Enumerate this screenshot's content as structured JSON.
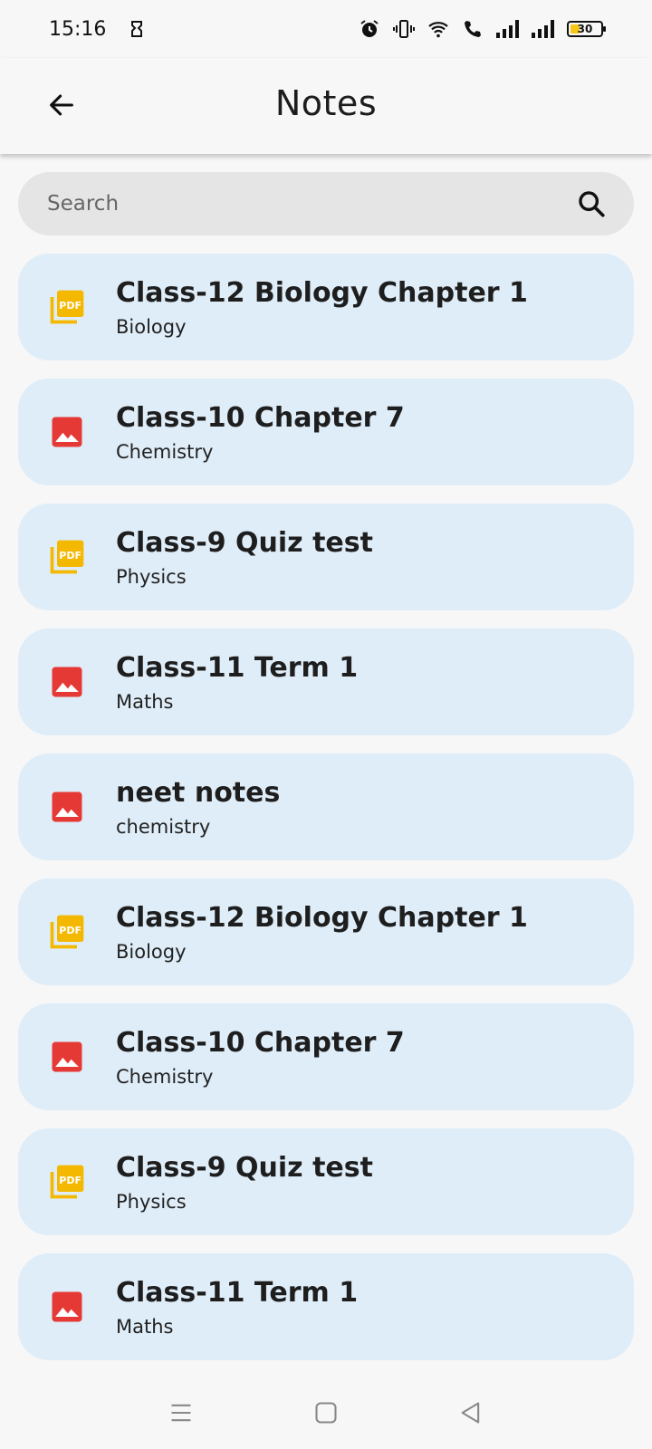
{
  "status_bar": {
    "time": "15:16",
    "battery_level": "30"
  },
  "app_bar": {
    "title": "Notes",
    "back_icon": "arrow-back-icon"
  },
  "search": {
    "placeholder": "Search",
    "value": "",
    "icon": "search-icon"
  },
  "colors": {
    "card_background": "#dfedf8",
    "pdf_icon": "#f5b800",
    "image_icon": "#e53935",
    "search_background": "#e5e5e5"
  },
  "notes": [
    {
      "title": "Class-12 Biology Chapter 1",
      "subject": "Biology",
      "type": "pdf"
    },
    {
      "title": "Class-10 Chapter 7",
      "subject": "Chemistry",
      "type": "image"
    },
    {
      "title": "Class-9 Quiz test",
      "subject": "Physics",
      "type": "pdf"
    },
    {
      "title": "Class-11 Term 1",
      "subject": "Maths",
      "type": "image"
    },
    {
      "title": "neet notes",
      "subject": "chemistry",
      "type": "image"
    },
    {
      "title": "Class-12 Biology Chapter 1",
      "subject": "Biology",
      "type": "pdf"
    },
    {
      "title": "Class-10 Chapter 7",
      "subject": "Chemistry",
      "type": "image"
    },
    {
      "title": "Class-9 Quiz test",
      "subject": "Physics",
      "type": "pdf"
    },
    {
      "title": "Class-11 Term 1",
      "subject": "Maths",
      "type": "image"
    }
  ],
  "nav_bar": {
    "icons": [
      "menu-icon",
      "home-square-icon",
      "back-triangle-icon"
    ]
  }
}
